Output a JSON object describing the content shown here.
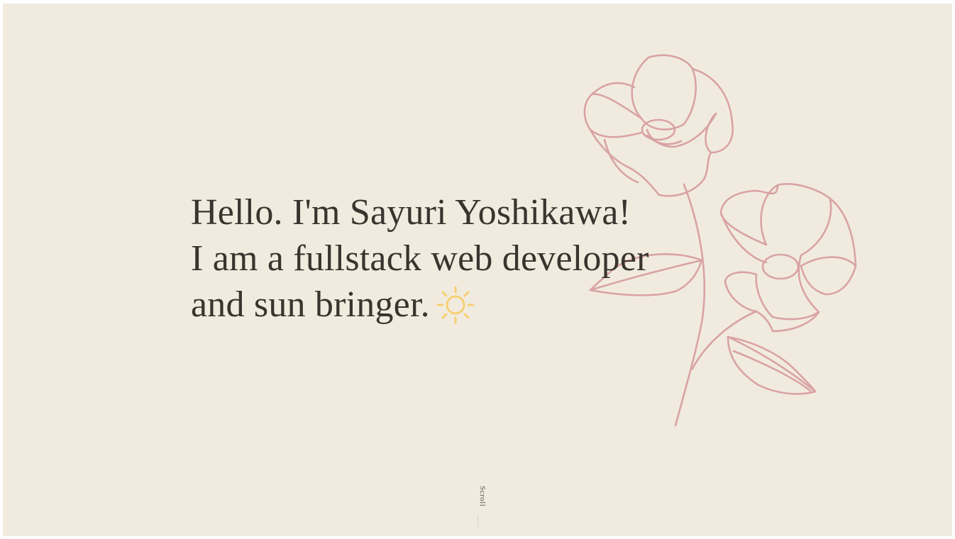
{
  "hero": {
    "line1": "Hello. I'm Sayuri Yoshikawa!",
    "line2": "I am a fullstack web developer",
    "line3": "and sun bringer."
  },
  "icons": {
    "sun": "sun-icon",
    "flower": "flower-illustration"
  },
  "scroll": {
    "label": "Scroll"
  },
  "colors": {
    "background": "#f1ebdf",
    "text": "#39342e",
    "flower_stroke": "#d9a3a3",
    "sun": "#f6cf73"
  }
}
